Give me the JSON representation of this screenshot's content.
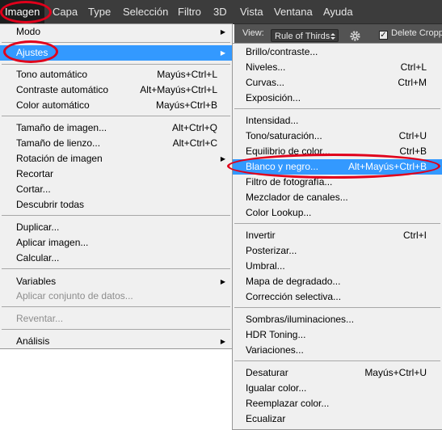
{
  "menubar": {
    "items": [
      "Imagen",
      "Capa",
      "Type",
      "Selección",
      "Filtro",
      "3D",
      "Vista",
      "Ventana",
      "Ayuda"
    ]
  },
  "options_bar": {
    "view_label": "View:",
    "view_value": "Rule of Thirds",
    "delete_cropped_label": "Delete Croppe",
    "delete_cropped_checked": true
  },
  "main_menu": {
    "modo": "Modo",
    "ajustes": "Ajustes",
    "tono_automatico": "Tono automático",
    "tono_automatico_sc": "Mayús+Ctrl+L",
    "contraste_automatico": "Contraste automático",
    "contraste_automatico_sc": "Alt+Mayús+Ctrl+L",
    "color_automatico": "Color automático",
    "color_automatico_sc": "Mayús+Ctrl+B",
    "tamano_imagen": "Tamaño de imagen...",
    "tamano_imagen_sc": "Alt+Ctrl+Q",
    "tamano_lienzo": "Tamaño de lienzo...",
    "tamano_lienzo_sc": "Alt+Ctrl+C",
    "rotacion": "Rotación de imagen",
    "recortar": "Recortar",
    "cortar": "Cortar...",
    "descubrir": "Descubrir todas",
    "duplicar": "Duplicar...",
    "aplicar_imagen": "Aplicar imagen...",
    "calcular": "Calcular...",
    "variables": "Variables",
    "aplicar_conjunto": "Aplicar conjunto de datos...",
    "reventar": "Reventar...",
    "analisis": "Análisis"
  },
  "sub_menu": {
    "brillo": "Brillo/contraste...",
    "niveles": "Niveles...",
    "niveles_sc": "Ctrl+L",
    "curvas": "Curvas...",
    "curvas_sc": "Ctrl+M",
    "exposicion": "Exposición...",
    "intensidad": "Intensidad...",
    "tono_saturacion": "Tono/saturación...",
    "tono_saturacion_sc": "Ctrl+U",
    "equilibrio": "Equilibrio de color...",
    "equilibrio_sc": "Ctrl+B",
    "blanco_negro": "Blanco y negro...",
    "blanco_negro_sc": "Alt+Mayús+Ctrl+B",
    "filtro_fotografia": "Filtro de fotografía...",
    "mezclador": "Mezclador de canales...",
    "color_lookup": "Color Lookup...",
    "invertir": "Invertir",
    "invertir_sc": "Ctrl+I",
    "posterizar": "Posterizar...",
    "umbral": "Umbral...",
    "mapa_degradado": "Mapa de degradado...",
    "correccion_selectiva": "Corrección selectiva...",
    "sombras": "Sombras/iluminaciones...",
    "hdr": "HDR Toning...",
    "variaciones": "Variaciones...",
    "desaturar": "Desaturar",
    "desaturar_sc": "Mayús+Ctrl+U",
    "igualar": "Igualar color...",
    "reemplazar": "Reemplazar color...",
    "ecualizar": "Ecualizar"
  },
  "colors": {
    "highlight": "#3399ff",
    "annotation": "#e0001b",
    "menubar": "#3c3c3c"
  }
}
